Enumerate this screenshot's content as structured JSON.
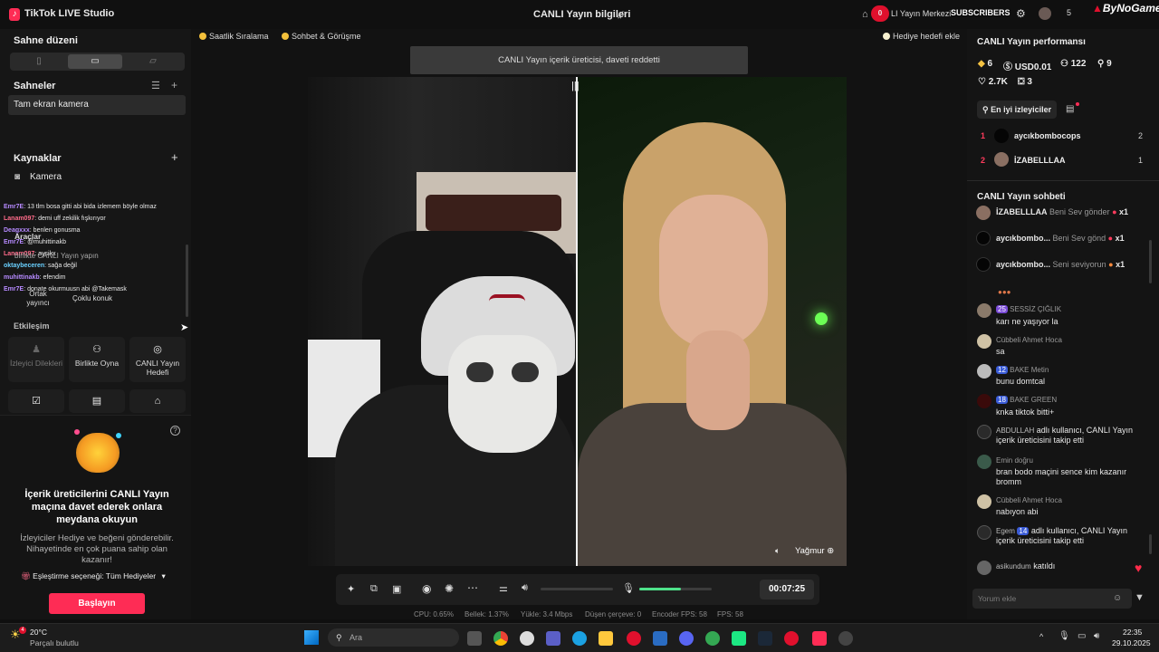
{
  "app": {
    "title": "TikTok LIVE Studio",
    "center_title": "CANLI Yayın bilgileri"
  },
  "titlebar": {
    "live_center": "LI Yayın Merkezi",
    "badge": "0",
    "subscribers_overlay": "SUBSCRIBERS",
    "overlay_brand": "ByNoGame",
    "count": "5"
  },
  "left": {
    "scene_layout": "Sahne düzeni",
    "scenes_title": "Sahneler",
    "scene_item": "Tam ekran kamera",
    "sources_title": "Kaynaklar",
    "source_camera": "Kamera",
    "tools_title": "Araçlar",
    "tools_collab": "birlikte CANLI Yayın yapın",
    "tool_cohost": "Ortak yayıncı",
    "tool_multiguest": "Çoklu konuk",
    "interaction_title": "Etkileşim",
    "tiles": [
      "İzleyici Dilekleri",
      "Birlikte Oyna",
      "CANLI Yayın Hedefi"
    ],
    "promo_title": "İçerik üreticilerini CANLI Yayın maçına davet ederek onlara meydana okuyun",
    "promo_desc": "İzleyiciler Hediye ve beğeni gönderebilir. Nihayetinde en çok puana sahip olan kazanır!",
    "match_option": "Eşleştirme seçeneği: Tüm Hediyeler",
    "start": "Başlayın"
  },
  "chat_overlay": [
    {
      "user": "Emr7E",
      "text": ": 13 tlm bosa gitti abi bida izlemem böyle olmaz"
    },
    {
      "user": "Lanam097",
      "text": ": demi uff zekilik fışkırıyor"
    },
    {
      "user": "Deagxxx",
      "text": ": benlen gonusma"
    },
    {
      "user": "Emr7E",
      "text": ": @muhittinakb"
    },
    {
      "user": "Lanam097",
      "text": ": aysikx"
    },
    {
      "user": "oktaybeceren",
      "text": ": sağa değil"
    },
    {
      "user": "muhittinakb",
      "text": ": efendim"
    },
    {
      "user": "Emr7E",
      "text": ": donate okurmuusn abi @Takemask"
    }
  ],
  "main": {
    "chip_hourly": "Saatlik Sıralama",
    "chip_chat": "Sohbet & Görüşme",
    "chip_gift_goal": "Hediye hedefi ekle",
    "notice": "CANLI Yayın içerik üreticisi, daveti reddetti",
    "guest_name": "Yağmur",
    "timer": "00:07:25",
    "stats": {
      "cpu": "CPU: 0.65%",
      "memory": "Bellek: 1.37%",
      "upload": "Yükle: 3.4 Mbps",
      "dropped": "Düşen çerçeve: 0",
      "encoder": "Encoder FPS: 58",
      "fps": "FPS: 58"
    }
  },
  "right": {
    "perf_title": "CANLI Yayın performansı",
    "metrics": {
      "diamonds": "6",
      "usd": "USD0.01",
      "viewers": "122",
      "followers": "9",
      "likes": "2.7K",
      "gifts": "3"
    },
    "top_viewers_tab": "En iyi izleyiciler",
    "top_viewers": [
      {
        "rank": "1",
        "name": "aycıkbombocops",
        "count": "2"
      },
      {
        "rank": "2",
        "name": "İZABELLLAA",
        "count": "1"
      }
    ],
    "chat_title": "CANLI Yayın sohbeti",
    "gifts": [
      {
        "name": "İZABELLLAA",
        "msg": "Beni Sev gönder",
        "qty": "x1"
      },
      {
        "name": "aycıkbombo...",
        "msg": "Beni Sev gönd",
        "qty": "x1"
      },
      {
        "name": "aycıkbombo...",
        "msg": "Seni seviyorun",
        "qty": "x1"
      }
    ],
    "comments": [
      {
        "name": "SESSİZ ÇIĞLIK",
        "badge": "25",
        "text": "karı ne yaşıyor la"
      },
      {
        "name": "Cübbeli Ahmet Hoca",
        "text": "sa"
      },
      {
        "name": "BAKE Metin",
        "badge": "12",
        "text": "bunu domtcal"
      },
      {
        "name": "BAKE GREEN",
        "badge": "18",
        "text": "knka tiktok bitti+"
      },
      {
        "name": "ABDULLAH",
        "text": "adlı kullanıcı, CANLI Yayın içerik üreticisini takip etti"
      },
      {
        "name": "Emin doğru",
        "text": "bran bodo maçini sence kim kazanır bromm"
      },
      {
        "name": "Cübbeli Ahmet Hoca",
        "text": "nabıyon abi"
      },
      {
        "name": "Egem",
        "badge": "14",
        "text": "adlı kullanıcı, CANLI Yayın içerik üreticisini takip etti"
      },
      {
        "name": "asikundum",
        "text": "katıldı"
      }
    ],
    "comment_placeholder": "Yorum ekle"
  },
  "taskbar": {
    "weather_temp": "20°C",
    "weather_desc": "Parçalı bulutlu",
    "search": "Ara",
    "time": "22:35",
    "date": "29.10.2025",
    "weather_badge": "4"
  },
  "colors": {
    "accent": "#fe2c55",
    "panel": "#161616",
    "green_meter": "#4ee28a"
  }
}
